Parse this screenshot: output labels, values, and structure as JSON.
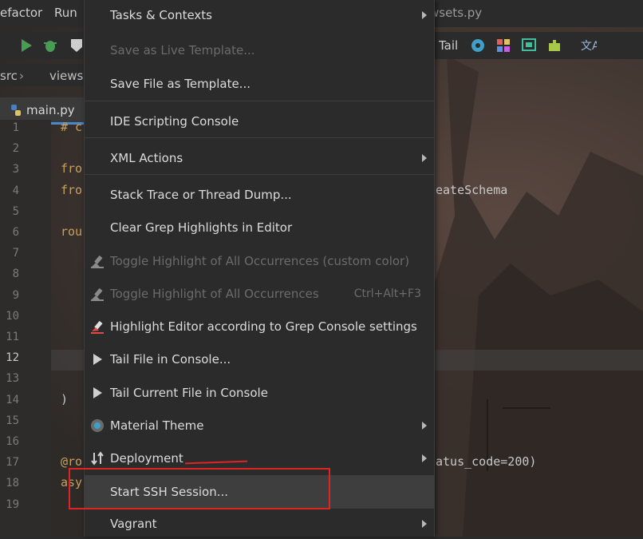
{
  "menubar": {
    "items": [
      "efactor",
      "Run"
    ],
    "file_title": "wsets.py"
  },
  "toolbar": {
    "tail_label": "Tail"
  },
  "breadcrumbs": [
    "src",
    "views"
  ],
  "editor": {
    "tab_label": "main.py",
    "line_numbers": [
      "1",
      "2",
      "3",
      "4",
      "5",
      "6",
      "7",
      "8",
      "9",
      "10",
      "11",
      "12",
      "13",
      "14",
      "15",
      "16",
      "17",
      "18",
      "19"
    ],
    "current_line": "12",
    "code_left": [
      {
        "line": "1",
        "text": "# c"
      },
      {
        "line": "3",
        "text": "fro"
      },
      {
        "line": "4",
        "text": "fro"
      },
      {
        "line": "6",
        "text": "rou"
      },
      {
        "line": "14",
        "text": ")"
      },
      {
        "line": "17",
        "text": "@ro"
      },
      {
        "line": "18",
        "text": "asy"
      }
    ],
    "code_right": [
      {
        "line": "4",
        "text": "eateSchema"
      },
      {
        "line": "17",
        "text": "atus_code=200)"
      }
    ]
  },
  "menu": {
    "items": [
      {
        "label": "Tasks & Contexts",
        "submenu": true,
        "disabled": false,
        "icon": ""
      },
      {
        "label": "Save as Live Template...",
        "submenu": false,
        "disabled": true,
        "icon": ""
      },
      {
        "label": "Save File as Template...",
        "submenu": false,
        "disabled": false,
        "icon": ""
      },
      {
        "label": "IDE Scripting Console",
        "submenu": false,
        "disabled": false,
        "icon": ""
      },
      {
        "label": "XML Actions",
        "submenu": true,
        "disabled": false,
        "icon": ""
      },
      {
        "label": "Stack Trace or Thread Dump...",
        "submenu": false,
        "disabled": false,
        "icon": ""
      },
      {
        "label": "Clear Grep Highlights in Editor",
        "submenu": false,
        "disabled": false,
        "icon": ""
      },
      {
        "label": "Toggle Highlight of All Occurrences (custom color)",
        "submenu": false,
        "disabled": true,
        "icon": "highlighter-icon"
      },
      {
        "label": "Toggle Highlight of All Occurrences",
        "submenu": false,
        "disabled": true,
        "icon": "highlighter-icon",
        "shortcut": "Ctrl+Alt+F3"
      },
      {
        "label": "Highlight Editor according to Grep Console settings",
        "submenu": false,
        "disabled": false,
        "icon": "highlighter-red-icon"
      },
      {
        "label": "Tail File in Console...",
        "submenu": false,
        "disabled": false,
        "icon": "play-icon"
      },
      {
        "label": "Tail Current File in Console",
        "submenu": false,
        "disabled": false,
        "icon": "play-icon"
      },
      {
        "label": "Material Theme",
        "submenu": true,
        "disabled": false,
        "icon": "material-theme-icon"
      },
      {
        "label": "Deployment",
        "submenu": true,
        "disabled": false,
        "icon": "deployment-icon"
      },
      {
        "label": "Start SSH Session...",
        "submenu": false,
        "disabled": false,
        "icon": "",
        "highlighted": true
      },
      {
        "label": "Vagrant",
        "submenu": true,
        "disabled": false,
        "icon": ""
      }
    ]
  },
  "colors": {
    "accent_green": "#499c54",
    "annotation_red": "#e02424",
    "menu_bg": "#2b2b2b",
    "highlight_bg": "#3e3e3e"
  }
}
